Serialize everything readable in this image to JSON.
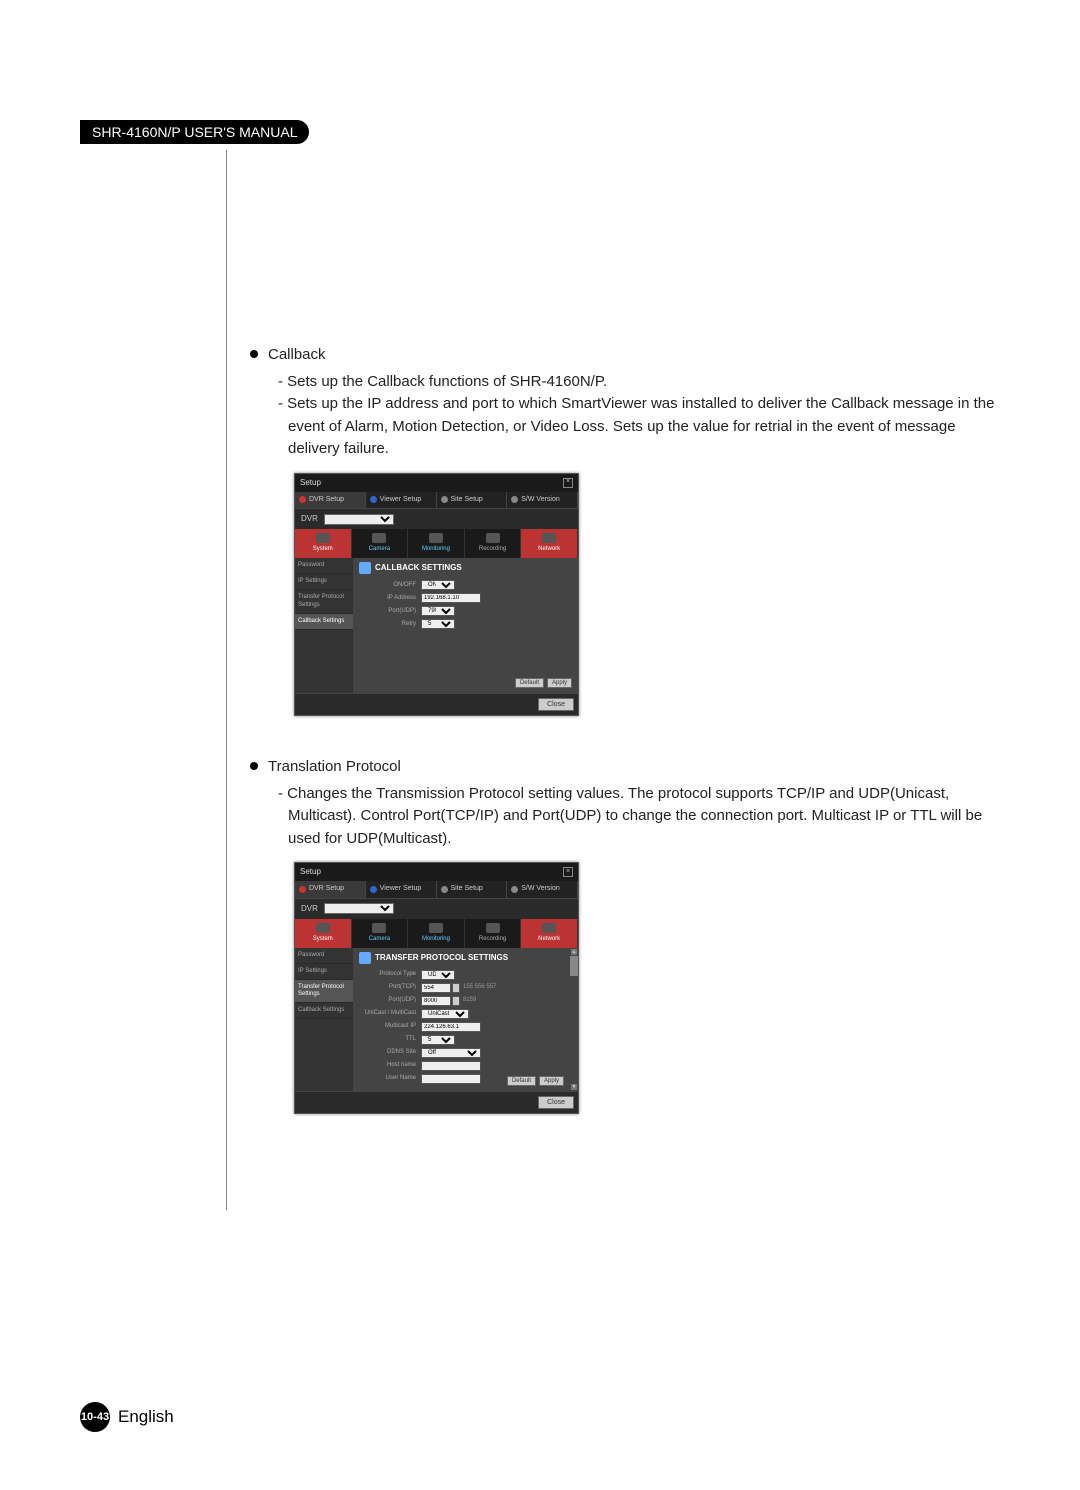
{
  "header": {
    "manual_title": "SHR-4160N/P USER'S MANUAL"
  },
  "section_callback": {
    "title": "Callback",
    "line1": "- Sets up the Callback functions of SHR-4160N/P.",
    "line2": "- Sets up the IP address and port to which SmartViewer was installed to deliver the Callback message in the event of Alarm, Motion Detection, or Video Loss. Sets up the value for retrial in the event of message delivery failure."
  },
  "section_transprot": {
    "title": "Translation Protocol",
    "line1": "- Changes the Transmission Protocol setting values. The protocol supports TCP/IP and UDP(Unicast, Multicast). Control Port(TCP/IP) and Port(UDP) to change the connection port. Multicast IP or TTL will be used for UDP(Multicast)."
  },
  "dialog_common": {
    "title": "Setup",
    "close": "×",
    "tab_dvr_setup": "DVR Setup",
    "tab_viewer_setup": "Viewer Setup",
    "tab_site_setup": "Site Setup",
    "tab_sw_version": "S/W Version",
    "dvr_label": "DVR",
    "dvr_value": "",
    "nav": {
      "system": "System",
      "camera": "Camera",
      "monitoring": "Monitoring",
      "recording": "Recording",
      "network": "Network"
    },
    "sidebar": {
      "password": "Password",
      "ip_settings": "IP Settings",
      "transfer_protocol": "Transfer Protocol Settings",
      "callback_settings": "Callback Settings"
    },
    "btn_default": "Default",
    "btn_apply": "Apply",
    "btn_close": "Close"
  },
  "callback_panel": {
    "header": "CALLBACK SETTINGS",
    "onoff_label": "ON/OFF",
    "onoff_value": "ON",
    "ip_label": "IP Address",
    "ip_value": "192.168.1.10",
    "port_label": "Port(UDP)",
    "port_value": "7900",
    "retry_label": "Retry",
    "retry_value": "5"
  },
  "transfer_panel": {
    "header": "TRANSFER PROTOCOL SETTINGS",
    "protocol_type_label": "Protocol Type",
    "protocol_type_value": "UDP",
    "port_tcp_label": "Port(TCP)",
    "port_tcp_value": "554",
    "port_tcp_aux": "155 556 557",
    "port_udp_label": "Port(UDP)",
    "port_udp_value": "8000",
    "port_udp_aux": "8159",
    "uni_multi_label": "UniCast / MultiCast",
    "uni_multi_value": "UniCast",
    "multicast_ip_label": "Multicast IP",
    "multicast_ip_value": "224.126.63.1",
    "ttl_label": "TTL",
    "ttl_value": "5",
    "ddns_site_label": "DDNS Site",
    "ddns_site_value": "Off",
    "hostname_label": "Host name",
    "hostname_value": "",
    "username_label": "User Name",
    "username_value": ""
  },
  "footer": {
    "page_number": "10-43",
    "language": "English"
  }
}
